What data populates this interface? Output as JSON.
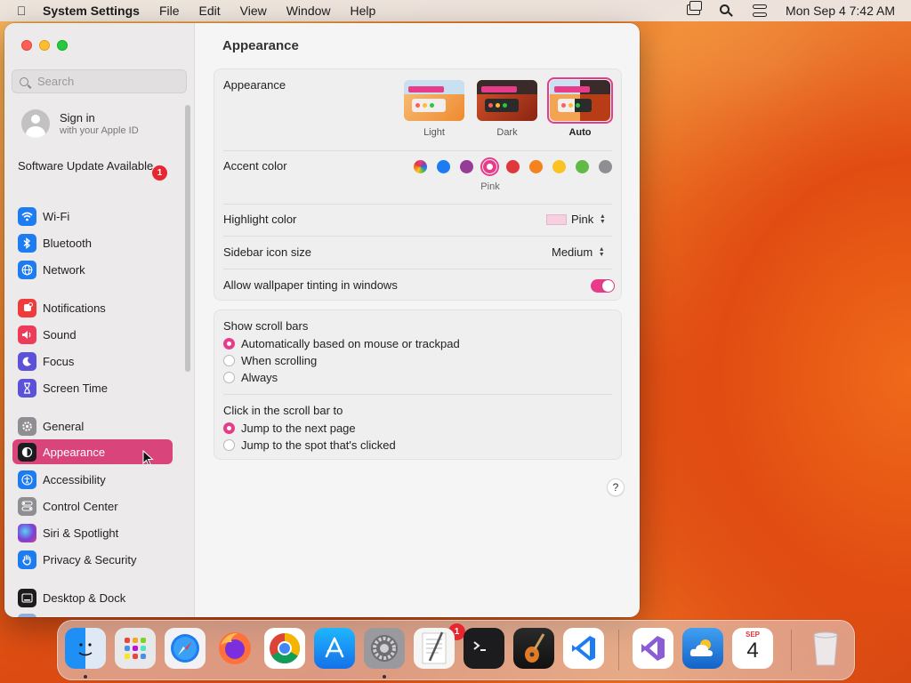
{
  "menubar": {
    "apple_icon": "apple-icon",
    "app_name": "System Settings",
    "menus": [
      "File",
      "Edit",
      "View",
      "Window",
      "Help"
    ],
    "clock": "Mon Sep 4  7:42 AM"
  },
  "sidebar": {
    "search_placeholder": "Search",
    "account": {
      "title": "Sign in",
      "subtitle": "with your Apple ID"
    },
    "software_update": {
      "label": "Software Update Available",
      "badge": "1"
    },
    "items": [
      {
        "label": "Wi-Fi",
        "icon": "wifi-icon",
        "color": "#1e7cf2"
      },
      {
        "label": "Bluetooth",
        "icon": "bluetooth-icon",
        "color": "#1e7cf2"
      },
      {
        "label": "Network",
        "icon": "globe-icon",
        "color": "#1e7cf2"
      },
      {
        "label": "Notifications",
        "icon": "bell-icon",
        "color": "#ee3b3b"
      },
      {
        "label": "Sound",
        "icon": "speaker-icon",
        "color": "#ee3b5a"
      },
      {
        "label": "Focus",
        "icon": "moon-icon",
        "color": "#5c52d9"
      },
      {
        "label": "Screen Time",
        "icon": "hourglass-icon",
        "color": "#5c52d9"
      },
      {
        "label": "General",
        "icon": "gear-icon",
        "color": "#8e8e93"
      },
      {
        "label": "Appearance",
        "icon": "appearance-icon",
        "color": "#1c1c1e"
      },
      {
        "label": "Accessibility",
        "icon": "accessibility-icon",
        "color": "#1e7cf2"
      },
      {
        "label": "Control Center",
        "icon": "control-center-icon",
        "color": "#8e8e93"
      },
      {
        "label": "Siri & Spotlight",
        "icon": "siri-icon",
        "color": "#7a3fd8"
      },
      {
        "label": "Privacy & Security",
        "icon": "hand-icon",
        "color": "#1e7cf2"
      },
      {
        "label": "Desktop & Dock",
        "icon": "dock-icon",
        "color": "#1c1c1e"
      }
    ],
    "selected": "Appearance"
  },
  "main": {
    "title": "Appearance",
    "appearance": {
      "label": "Appearance",
      "options": [
        "Light",
        "Dark",
        "Auto"
      ],
      "selected": "Auto"
    },
    "accent": {
      "label": "Accent color",
      "colors": [
        "multicolor",
        "#1e7cf2",
        "#953d96",
        "#e63c89",
        "#e0373d",
        "#f5821f",
        "#fbc224",
        "#62ba46",
        "#8e8e93"
      ],
      "selected_name": "Pink"
    },
    "highlight": {
      "label": "Highlight color",
      "value": "Pink",
      "swatch": "#f7cfe0"
    },
    "sidebar_icon_size": {
      "label": "Sidebar icon size",
      "value": "Medium"
    },
    "wallpaper_tinting": {
      "label": "Allow wallpaper tinting in windows",
      "on": true
    },
    "scroll_bars": {
      "label": "Show scroll bars",
      "options": [
        "Automatically based on mouse or trackpad",
        "When scrolling",
        "Always"
      ],
      "selected": 0
    },
    "click_scroll": {
      "label": "Click in the scroll bar to",
      "options": [
        "Jump to the next page",
        "Jump to the spot that's clicked"
      ],
      "selected": 0
    },
    "help": "?"
  },
  "dock": {
    "apps": [
      "Finder",
      "Launchpad",
      "Safari",
      "Firefox",
      "Chrome",
      "App Store",
      "System Settings",
      "TextEdit",
      "Terminal",
      "GarageBand",
      "VS Code",
      "Visual Studio",
      "Weather",
      "Calendar",
      "Trash"
    ],
    "settings_badge": "1",
    "calendar": {
      "month": "SEP",
      "day": "4"
    }
  }
}
